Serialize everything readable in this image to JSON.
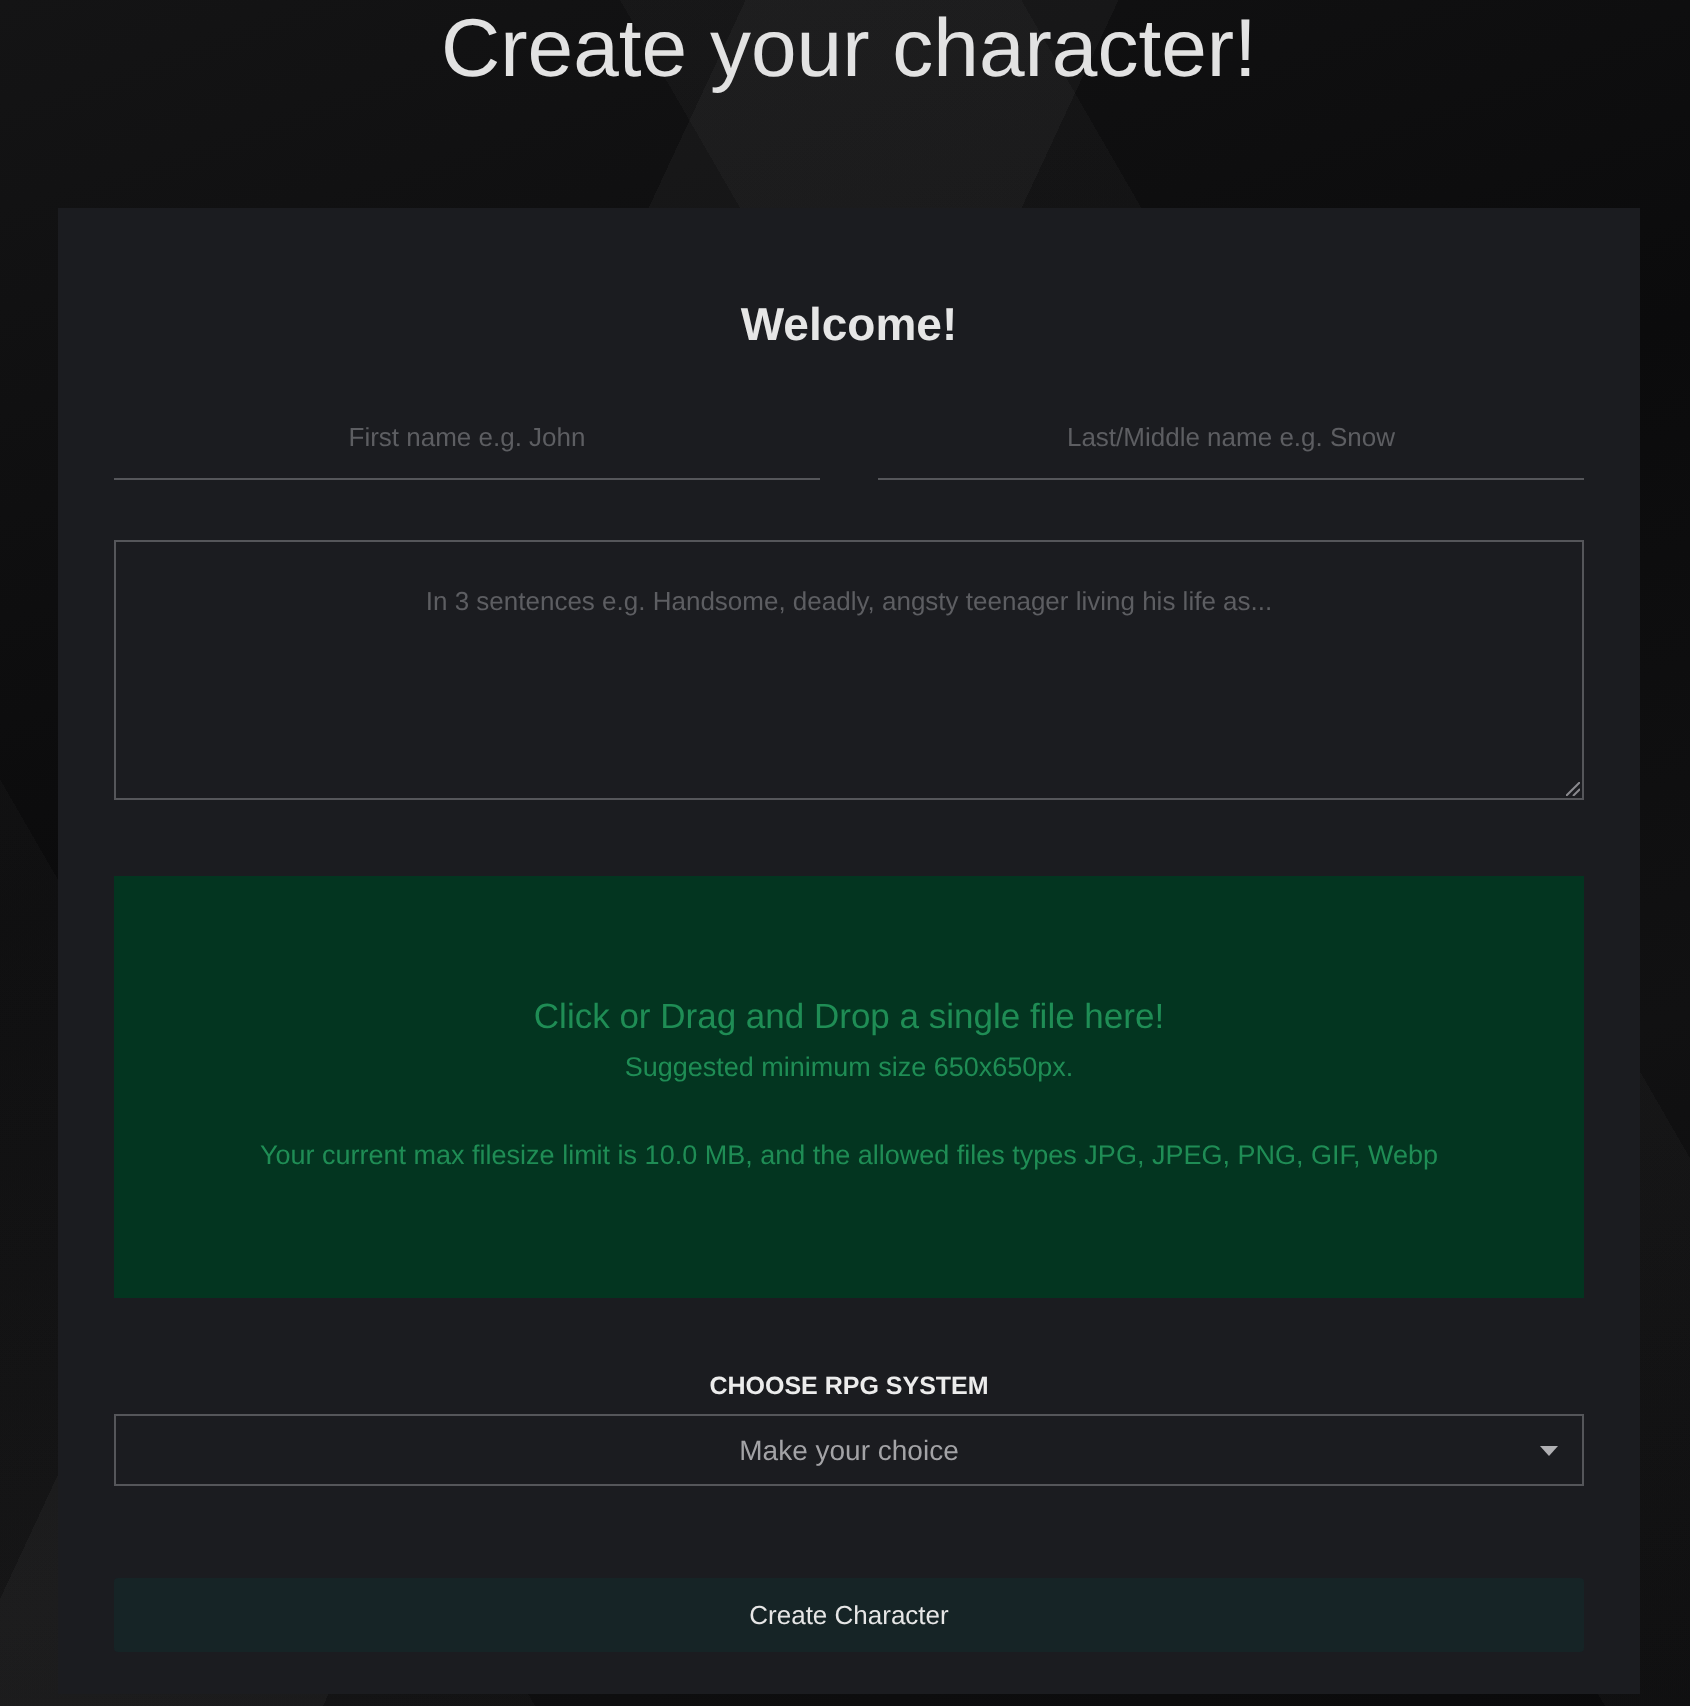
{
  "page": {
    "title": "Create your character!"
  },
  "form": {
    "heading": "Welcome!",
    "name_fields": [
      {
        "placeholder": "First name e.g. John"
      },
      {
        "placeholder": "Last/Middle name e.g. Snow"
      }
    ],
    "description_field": {
      "placeholder": "In 3 sentences e.g. Handsome, deadly, angsty teenager living his life as..."
    },
    "upload_zone": {
      "title": "Click or Drag and Drop a single file here!",
      "hint": "Suggested minimum size 650x650px.",
      "limits": "Your current max filesize limit is 10.0 MB, and the allowed files types JPG, JPEG, PNG, GIF, Webp"
    },
    "rpg_system": {
      "label": "CHOOSE RPG SYSTEM",
      "placeholder": "Make your choice"
    },
    "submit_button": "Create Character"
  }
}
